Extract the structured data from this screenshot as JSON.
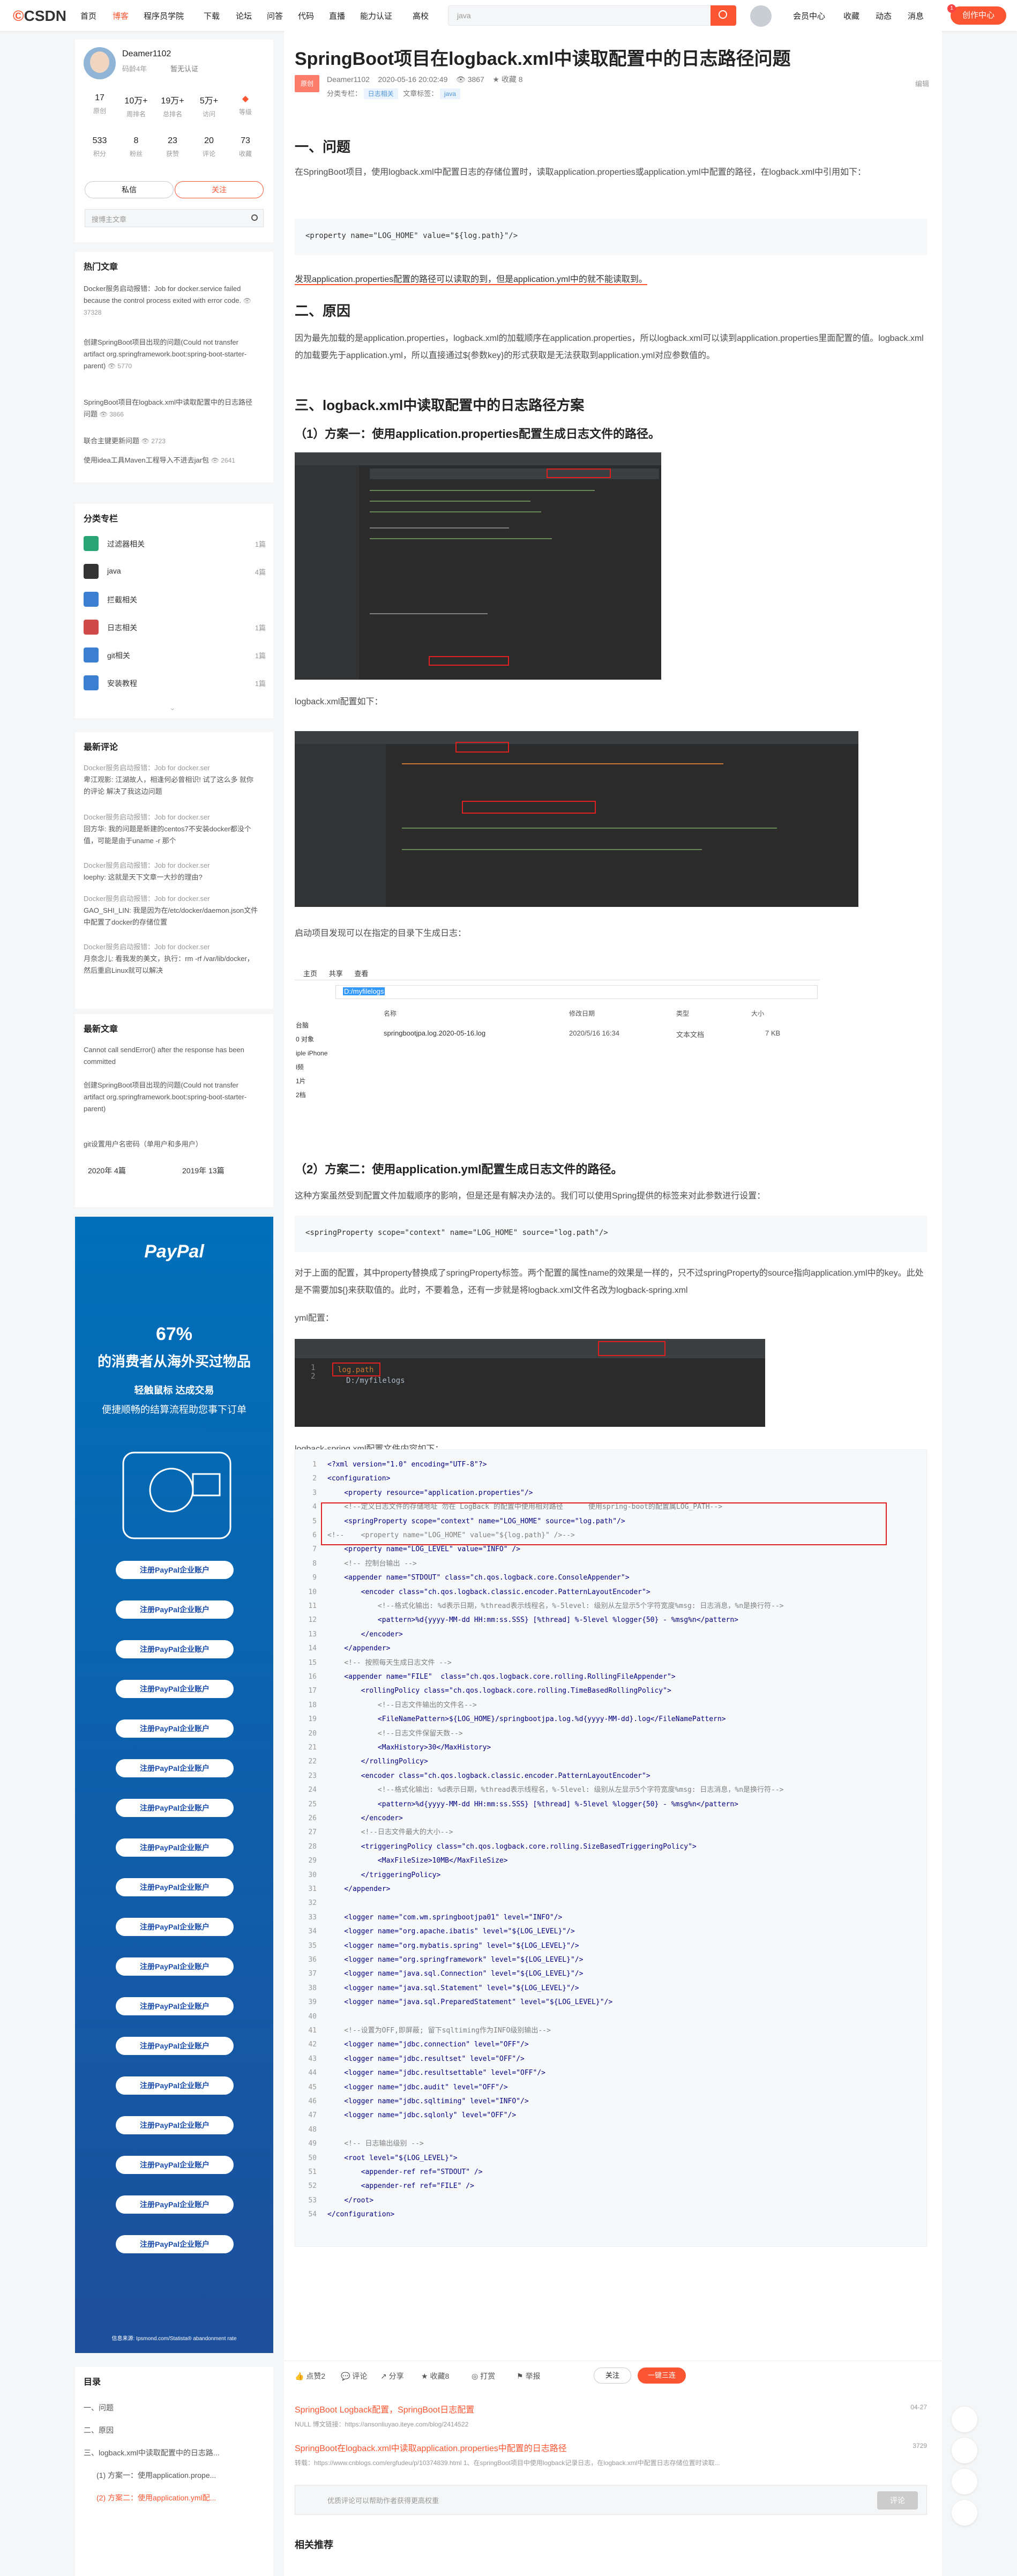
{
  "topbar": {
    "logo": "CSDN",
    "nav": [
      "首页",
      "博客",
      "程序员学院",
      "下载",
      "论坛",
      "问答",
      "代码",
      "直播",
      "能力认证",
      "高校"
    ],
    "search_placeholder": "java",
    "right": [
      "会员中心",
      "收藏",
      "动态",
      "消息"
    ],
    "create": "创作中心",
    "badge": "1"
  },
  "profile": {
    "name": "Deamer1102",
    "age": "码龄4年",
    "verify": "暂无认证",
    "stats1": [
      {
        "v": "17",
        "l": "原创"
      },
      {
        "v": "10万+",
        "l": "周排名"
      },
      {
        "v": "19万+",
        "l": "总排名"
      },
      {
        "v": "5万+",
        "l": "访问"
      },
      {
        "v": "",
        "l": "等级"
      }
    ],
    "stats2": [
      {
        "v": "533",
        "l": "积分"
      },
      {
        "v": "8",
        "l": "粉丝"
      },
      {
        "v": "23",
        "l": "获赞"
      },
      {
        "v": "20",
        "l": "评论"
      },
      {
        "v": "73",
        "l": "收藏"
      }
    ],
    "msg_btn": "私信",
    "follow_btn": "关注",
    "search_placeholder": "搜博主文章"
  },
  "hot": {
    "title": "热门文章",
    "items": [
      {
        "text": "Docker服务启动报错：Job for docker.service failed because the control process exited with error code.",
        "cnt": "37328"
      },
      {
        "text": "创建SpringBoot项目出现的问题(Could not transfer artifact org.springframework.boot:spring-boot-starter-parent)",
        "cnt": "5770"
      },
      {
        "text": "SpringBoot项目在logback.xml中读取配置中的日志路径问题",
        "cnt": "3866"
      },
      {
        "text": "联合主键更新问题",
        "cnt": "2723"
      },
      {
        "text": "使用idea工具Maven工程导入不进去jar包",
        "cnt": "2641"
      }
    ]
  },
  "cats": {
    "title": "分类专栏",
    "items": [
      {
        "name": "过滤器相关",
        "cnt": "1篇",
        "color": "#2aa676"
      },
      {
        "name": "java",
        "cnt": "4篇",
        "color": "#333"
      },
      {
        "name": "拦截相关",
        "cnt": "",
        "color": "#3b7fd1"
      },
      {
        "name": "日志相关",
        "cnt": "1篇",
        "color": "#d04a4a"
      },
      {
        "name": "git相关",
        "cnt": "1篇",
        "color": "#3b7fd1"
      },
      {
        "name": "安装教程",
        "cnt": "1篇",
        "color": "#3b7fd1"
      }
    ]
  },
  "recent_comments": {
    "title": "最新评论",
    "items": [
      {
        "a": "Docker服务启动报错：Job for docker.ser",
        "b": "卑江观影: 江湖故人，相逢何必曾相识! 试了这么多 就你的评论 解决了我这边问题"
      },
      {
        "a": "Docker服务启动报错：Job for docker.ser",
        "b": "回方华: 我的问题是新建的centos7不安装docker都没个值，可能是由于uname -r 那个"
      },
      {
        "a": "Docker服务启动报错：Job for docker.ser",
        "b": "loephy: 这就是天下文章一大抄的理由?"
      },
      {
        "a": "Docker服务启动报错：Job for docker.ser",
        "b": "GAO_SHI_LIN: 我是因为在/etc/docker/daemon.json文件中配置了docker的存储位置"
      },
      {
        "a": "Docker服务启动报错：Job for docker.ser",
        "b": "月奈念儿: 看我发的美文，执行：rm -rf /var/lib/docker，然后重启Linux就可以解决"
      }
    ]
  },
  "latest": {
    "title": "最新文章",
    "items": [
      "Cannot call sendError() after the response has been committed",
      "创建SpringBoot项目出现的问题(Could not transfer artifact org.springframework.boot:spring-boot-starter-parent)",
      "git设置用户名密码（单用户和多用户）"
    ],
    "archive": [
      {
        "y": "2020年",
        "n": "4篇"
      },
      {
        "y": "2019年",
        "n": "13篇"
      }
    ]
  },
  "ad": {
    "brand": "PayPal",
    "pct": "67%",
    "line1": "的消费者从海外买过物品",
    "line2": "轻触鼠标 达成交易",
    "line3": "便捷顺畅的结算流程助您事下订单",
    "btn": "注册PayPal企业账户",
    "foot": "信息来源: Ipsmond.com/Statista® abandonment rate"
  },
  "toc": {
    "title": "目录",
    "items": [
      "一、问题",
      "二、原因",
      "三、logback.xml中读取配置中的日志路...",
      "(1) 方案一：使用application.prope...",
      "(2) 方案二：使用application.yml配..."
    ]
  },
  "article": {
    "title": "SpringBoot项目在logback.xml中读取配置中的日志路径问题",
    "badge": "原创",
    "author": "Deamer1102",
    "date": "2020-05-16 20:02:49",
    "views": "3867",
    "fav": "收藏 8",
    "edit": "编辑",
    "column_label": "分类专栏：",
    "tags": [
      "日志相关",
      "文章标签：",
      "java"
    ],
    "h_problem": "一、问题",
    "p_problem": "在SpringBoot项目，使用logback.xml中配置日志的存储位置时，读取application.properties或application.yml中配置的路径，在logback.xml中引用如下：",
    "code1": "<property name=\"LOG_HOME\" value=\"${log.path}\"/>",
    "p_found": "发现application.properties配置的路径可以读取的到，但是application.yml中的就不能读取到。",
    "h_reason": "二、原因",
    "p_reason": "因为最先加载的是application.properties，logback.xml的加载顺序在application.properties，所以logback.xml可以读到application.properties里面配置的值。logback.xml的加载要先于application.yml，所以直接通过${参数key}的形式获取是无法获取到application.yml对应参数值的。",
    "h_solution": "三、logback.xml中读取配置中的日志路径方案",
    "h_opt1": "（1）方案一：使用application.properties配置生成日志文件的路径。",
    "p_logback_cfg": "logback.xml配置如下：",
    "p_start": "启动项目发现可以在指定的目录下生成日志：",
    "h_opt2": "（2）方案二：使用application.yml配置生成日志文件的路径。",
    "p_opt2": "这种方案虽然受到配置文件加载顺序的影响，但是还是有解决办法的。我们可以使用Spring提供的标签来对此参数进行设置：",
    "code2": "<springProperty scope=\"context\" name=\"LOG_HOME\" source=\"log.path\"/>",
    "p_opt2b": "对于上面的配置，其中property替换成了springProperty标签。两个配置的属性name的效果是一样的，只不过springProperty的source指向application.yml中的key。此处是不需要加${}来获取值的。此时，不要着急，还有一步就是将logback.xml文件名改为logback-spring.xml",
    "p_yml": "yml配置：",
    "p_spring_cfg": "logback-spring.xml配置文件内容如下：",
    "explorer": {
      "tabs": [
        "主页",
        "共享",
        "查看"
      ],
      "path": "D:/myfilelogs",
      "cols": [
        "名称",
        "修改日期",
        "类型",
        "大小"
      ],
      "file": "springbootjpa.log.2020-05-16.log",
      "fdate": "2020/5/16 16:34",
      "ftype": "文本文档",
      "fsize": "7 KB",
      "left": [
        "台脑",
        "0 对象",
        "iple iPhone",
        "l频",
        "1片",
        "2档"
      ]
    },
    "yml_code": [
      "log.path",
      "D:/myfilelogs"
    ]
  },
  "bigcode": [
    "<?xml version=\"1.0\" encoding=\"UTF-8\"?>",
    "<configuration>",
    "    <property resource=\"application.properties\"/>",
    "    <!--定义日志文件的存储地址 勿在 LogBack 的配置中使用相对路径      使用spring-boot的配置属LOG_PATH-->",
    "    <springProperty scope=\"context\" name=\"LOG_HOME\" source=\"log.path\"/>",
    "<!--    <property name=\"LOG_HOME\" value=\"${log.path}\" />-->",
    "    <property name=\"LOG_LEVEL\" value=\"INFO\" />",
    "    <!-- 控制台输出 -->",
    "    <appender name=\"STDOUT\" class=\"ch.qos.logback.core.ConsoleAppender\">",
    "        <encoder class=\"ch.qos.logback.classic.encoder.PatternLayoutEncoder\">",
    "            <!--格式化输出: %d表示日期，%thread表示线程名，%-5level: 级别从左显示5个字符宽度%msg: 日志消息，%n是换行符-->",
    "            <pattern>%d{yyyy-MM-dd HH:mm:ss.SSS} [%thread] %-5level %logger{50} - %msg%n</pattern>",
    "        </encoder>",
    "    </appender>",
    "    <!-- 按照每天生成日志文件 -->",
    "    <appender name=\"FILE\"  class=\"ch.qos.logback.core.rolling.RollingFileAppender\">",
    "        <rollingPolicy class=\"ch.qos.logback.core.rolling.TimeBasedRollingPolicy\">",
    "            <!--日志文件输出的文件名-->",
    "            <FileNamePattern>${LOG_HOME}/springbootjpa.log.%d{yyyy-MM-dd}.log</FileNamePattern>",
    "            <!--日志文件保留天数-->",
    "            <MaxHistory>30</MaxHistory>",
    "        </rollingPolicy>",
    "        <encoder class=\"ch.qos.logback.classic.encoder.PatternLayoutEncoder\">",
    "            <!--格式化输出: %d表示日期，%thread表示线程名，%-5level: 级别从左显示5个字符宽度%msg: 日志消息，%n是换行符-->",
    "            <pattern>%d{yyyy-MM-dd HH:mm:ss.SSS} [%thread] %-5level %logger{50} - %msg%n</pattern>",
    "        </encoder>",
    "        <!--日志文件最大的大小-->",
    "        <triggeringPolicy class=\"ch.qos.logback.core.rolling.SizeBasedTriggeringPolicy\">",
    "            <MaxFileSize>10MB</MaxFileSize>",
    "        </triggeringPolicy>",
    "    </appender>",
    "",
    "    <logger name=\"com.wm.springbootjpa01\" level=\"INFO\"/>",
    "    <logger name=\"org.apache.ibatis\" level=\"${LOG_LEVEL}\"/>",
    "    <logger name=\"org.mybatis.spring\" level=\"${LOG_LEVEL}\"/>",
    "    <logger name=\"org.springframework\" level=\"${LOG_LEVEL}\"/>",
    "    <logger name=\"java.sql.Connection\" level=\"${LOG_LEVEL}\"/>",
    "    <logger name=\"java.sql.Statement\" level=\"${LOG_LEVEL}\"/>",
    "    <logger name=\"java.sql.PreparedStatement\" level=\"${LOG_LEVEL}\"/>",
    "",
    "    <!--设置为OFF,即屏蔽; 留下sqltiming作为INFO级别输出-->",
    "    <logger name=\"jdbc.connection\" level=\"OFF\"/>",
    "    <logger name=\"jdbc.resultset\" level=\"OFF\"/>",
    "    <logger name=\"jdbc.resultsettable\" level=\"OFF\"/>",
    "    <logger name=\"jdbc.audit\" level=\"OFF\"/>",
    "    <logger name=\"jdbc.sqltiming\" level=\"INFO\"/>",
    "    <logger name=\"jdbc.sqlonly\" level=\"OFF\"/>",
    "",
    "    <!-- 日志输出级别 -->",
    "    <root level=\"${LOG_LEVEL}\">",
    "        <appender-ref ref=\"STDOUT\" />",
    "        <appender-ref ref=\"FILE\" />",
    "    </root>",
    "</configuration>"
  ],
  "toolbar": {
    "like": "点赞2",
    "comment": "评论",
    "share": "分享",
    "fav": "收藏8",
    "reward": "打赏",
    "report": "举报",
    "follow": "关注",
    "triple": "一键三连"
  },
  "related": [
    {
      "t": "SpringBoot Logback配置，SpringBoot日志配置",
      "sub": "NULL 博文链接：https://ansonliuyao.iteye.com/blog/2414522",
      "d": "04-27"
    },
    {
      "t": "SpringBoot在logback.xml中读取application.properties中配置的日志路径",
      "sub": "转载：https://www.cnblogs.com/ergfudeu/p/10374839.html 1、在springBoot项目中使用logback记录日志，在logback.xml中配置日志存储位置时读取...",
      "d": "3729"
    }
  ],
  "comment_placeholder": "优质评论可以帮助作者获得更高权重",
  "comment_btn": "评论",
  "recommend_title": "相关推荐"
}
